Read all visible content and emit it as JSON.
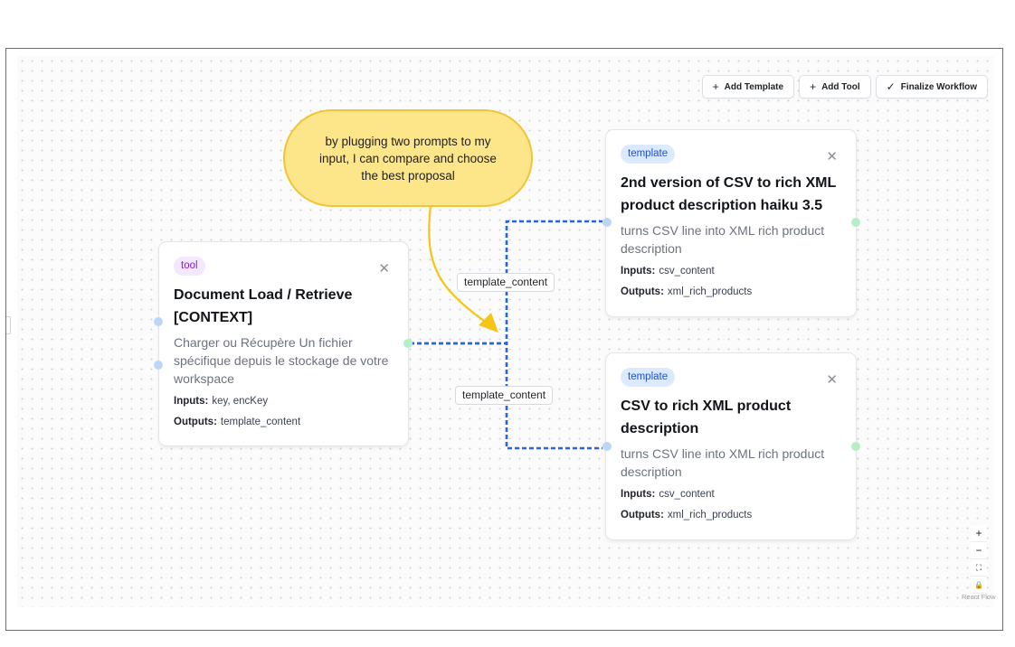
{
  "toolbar": {
    "add_template": "Add Template",
    "add_tool": "Add Tool",
    "finalize": "Finalize Workflow"
  },
  "annotation": {
    "text": "by plugging two prompts to my input, I can compare and choose the best proposal",
    "color": "#fde68a"
  },
  "nodes": {
    "tool": {
      "badge": "tool",
      "title": "Document Load / Retrieve [CONTEXT]",
      "description": "Charger ou Récupère Un fichier spécifique depuis le stockage de votre workspace",
      "inputs_label": "Inputs:",
      "inputs": "key, encKey",
      "outputs_label": "Outputs:",
      "outputs": "template_content"
    },
    "template1": {
      "badge": "template",
      "title": "2nd version of CSV to rich XML product description haiku 3.5",
      "description": "turns CSV line into XML rich product description",
      "inputs_label": "Inputs:",
      "inputs": "csv_content",
      "outputs_label": "Outputs:",
      "outputs": "xml_rich_products"
    },
    "template2": {
      "badge": "template",
      "title": "CSV to rich XML product description",
      "description": "turns CSV line into XML rich product description",
      "inputs_label": "Inputs:",
      "inputs": "csv_content",
      "outputs_label": "Outputs:",
      "outputs": "xml_rich_products"
    }
  },
  "edges": [
    {
      "label": "template_content"
    },
    {
      "label": "template_content"
    }
  ],
  "controls": {
    "zoom_in": "+",
    "zoom_out": "−",
    "fit_view": "⛶",
    "lock": "🔒"
  },
  "attribution": "React Flow",
  "colors": {
    "edge": "#2563eb",
    "arrow": "#f5c518"
  }
}
